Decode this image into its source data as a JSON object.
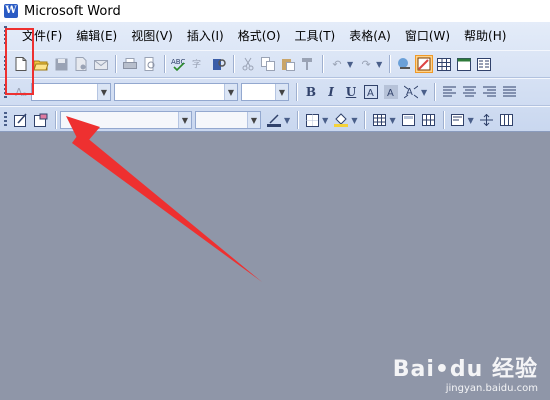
{
  "window": {
    "title": "Microsoft Word",
    "app_logo": "W"
  },
  "menubar": {
    "items": [
      "文件(F)",
      "编辑(E)",
      "视图(V)",
      "插入(I)",
      "格式(O)",
      "工具(T)",
      "表格(A)",
      "窗口(W)",
      "帮助(H)"
    ]
  },
  "toolbar_format": {
    "style_label": "Aₐ",
    "style_value": "",
    "font_value": "",
    "size_value": "",
    "bold": "B",
    "italic": "I",
    "underline": "U"
  },
  "annotation": {
    "color": "#ee3030"
  },
  "watermark": {
    "logo": "Bai•du 经验",
    "url": "jingyan.baidu.com"
  }
}
